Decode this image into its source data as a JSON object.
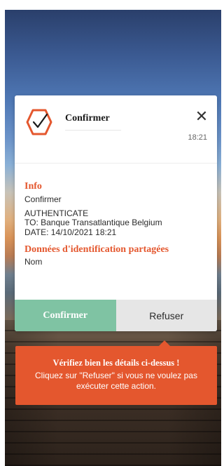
{
  "dialog": {
    "title": "Confirmer",
    "time": "18:21",
    "info_heading": "Info",
    "info_lines": [
      "Confirmer",
      "AUTHENTICATE",
      "TO: Banque Transatlantique Belgium",
      "DATE: 14/10/2021 18:21"
    ],
    "shared_heading": "Données d'identification partagées",
    "shared_items": [
      "Nom"
    ],
    "confirm_label": "Confirmer",
    "refuse_label": "Refuser"
  },
  "warning": {
    "title": "Vérifiez bien les détails ci-dessus !",
    "text": "Cliquez sur \"Refuser\" si vous ne voulez pas exécuter cette action."
  },
  "icons": {
    "logo": "check-hexagon-icon",
    "close": "close-icon"
  },
  "colors": {
    "accent": "#e4572e",
    "confirm": "#7fc3a3",
    "refuse": "#e6e6e6"
  }
}
